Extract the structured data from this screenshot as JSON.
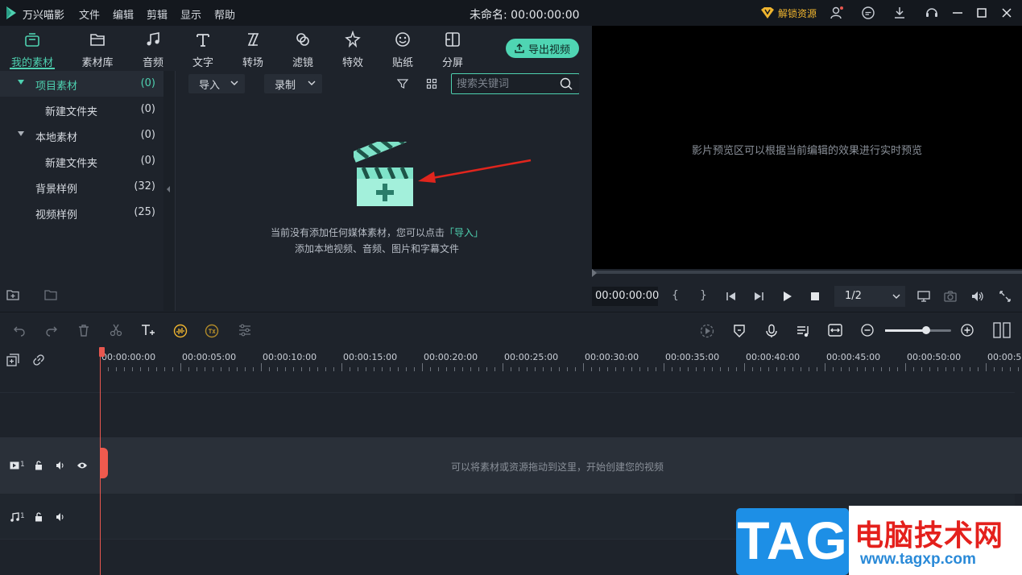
{
  "app": {
    "name": "万兴喵影",
    "title": "未命名: 00:00:00:00"
  },
  "menu": [
    "文件",
    "编辑",
    "剪辑",
    "显示",
    "帮助"
  ],
  "titlebar_right": {
    "unlock_label": "解锁资源"
  },
  "tools": [
    {
      "label": "我的素材",
      "icon": "folder-box-icon",
      "active": true
    },
    {
      "label": "素材库",
      "icon": "folder-icon"
    },
    {
      "label": "音频",
      "icon": "music-note-icon"
    },
    {
      "label": "文字",
      "icon": "text-icon"
    },
    {
      "label": "转场",
      "icon": "transition-icon"
    },
    {
      "label": "滤镜",
      "icon": "filter-icon"
    },
    {
      "label": "特效",
      "icon": "effects-star-icon"
    },
    {
      "label": "贴纸",
      "icon": "sticker-icon"
    },
    {
      "label": "分屏",
      "icon": "split-screen-icon"
    }
  ],
  "export_label": "导出视频",
  "tree": [
    {
      "name": "项目素材",
      "count": "(0)",
      "selected": true,
      "expandable": true
    },
    {
      "name": "新建文件夹",
      "count": "(0)",
      "indent": true
    },
    {
      "name": "本地素材",
      "count": "(0)",
      "expandable": true
    },
    {
      "name": "新建文件夹",
      "count": "(0)",
      "indent": true
    },
    {
      "name": "背景样例",
      "count": "(32)"
    },
    {
      "name": "视频样例",
      "count": "(25)"
    }
  ],
  "media": {
    "import_label": "导入",
    "record_label": "录制",
    "search_placeholder": "搜索关键词",
    "empty_line1_pre": "当前没有添加任何媒体素材，您可以点击",
    "empty_line1_link": "「导入」",
    "empty_line2": "添加本地视频、音频、图片和字幕文件"
  },
  "preview": {
    "hint": "影片预览区可以根据当前编辑的效果进行实时预览",
    "time": "00:00:00:00",
    "brace_open": "{",
    "brace_close": "}",
    "ratio": "1/2",
    "progress": 0
  },
  "ruler": [
    "00:00:00:00",
    "00:00:05:00",
    "00:00:10:00",
    "00:00:15:00",
    "00:00:20:00",
    "00:00:25:00",
    "00:00:30:00",
    "00:00:35:00",
    "00:00:40:00",
    "00:00:45:00",
    "00:00:50:00",
    "00:00:5"
  ],
  "tracks": {
    "video_num": "1",
    "audio_num": "1",
    "drop_hint": "可以将素材或资源拖动到这里，开始创建您的视频"
  },
  "zoom_level": 0.6,
  "watermark": {
    "tag": "TAG",
    "site_cn": "电脑技术网",
    "url": "www.tagxp.com"
  },
  "colors": {
    "accent": "#4ed1b0",
    "playhead": "#e8574f",
    "unlock": "#f0b52f"
  }
}
